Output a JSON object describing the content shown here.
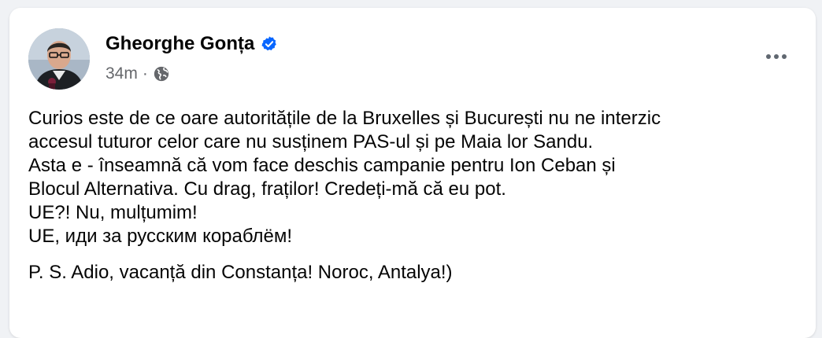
{
  "post": {
    "author": {
      "name": "Gheorghe Gonța",
      "verified": true,
      "verified_icon": "verified-badge-icon",
      "avatar_icon": "avatar"
    },
    "meta": {
      "timestamp": "34m",
      "separator": "·",
      "audience_icon": "globe-icon"
    },
    "more_icon": "more-horizontal-icon",
    "body_lines": [
      "Curios este de ce oare autoritățile de la Bruxelles și București nu ne interzic",
      "accesul tuturor celor care nu susținem PAS-ul și pe Maia lor Sandu.",
      "Asta e - înseamnă că vom face deschis campanie pentru Ion Ceban și",
      "Blocul Alternativa. Cu drag, fraților! Credeți-mă că eu pot.",
      "UE?! Nu, mulțumim!",
      "UE, иди за русским кораблём!"
    ],
    "ps_line": "P. S. Adio, vacanță din Constanța! Noroc, Antalya!)",
    "colors": {
      "background": "#f0f2f5",
      "card": "#ffffff",
      "text": "#050505",
      "secondary_text": "#65676b",
      "verified_blue": "#0866ff"
    }
  }
}
